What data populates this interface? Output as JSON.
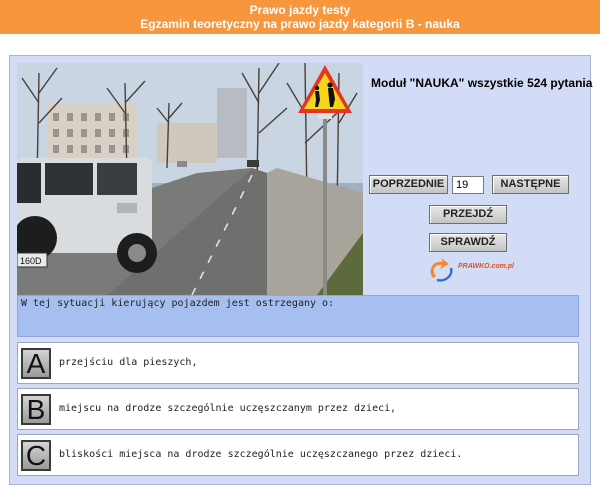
{
  "header": {
    "title": "Prawo jazdy testy",
    "subtitle": "Egzamin teoretyczny na prawo jazdy kategorii B - nauka"
  },
  "module": {
    "title": "Moduł \"NAUKA\" wszystkie 524 pytania"
  },
  "nav": {
    "prev_label": "POPRZEDNIE",
    "next_label": "NASTĘPNE",
    "question_number": "19",
    "go_label": "PRZEJDŹ",
    "check_label": "SPRAWDŹ"
  },
  "logo": {
    "text": "PRAWKO.com.pl"
  },
  "photo": {
    "plate": "160D"
  },
  "question": {
    "text": "W tej sytuacji kierujący pojazdem jest ostrzegany o:"
  },
  "answers": [
    {
      "letter": "A",
      "text": "przejściu dla pieszych,"
    },
    {
      "letter": "B",
      "text": "miejscu na drodze szczególnie uczęszczanym przez dzieci,"
    },
    {
      "letter": "C",
      "text": "bliskości miejsca na drodze szczególnie uczęszczanego przez dzieci."
    }
  ],
  "colors": {
    "header_bg": "#f7963c",
    "frame_bg": "#d3dcf6",
    "question_bg": "#a6bef0"
  }
}
